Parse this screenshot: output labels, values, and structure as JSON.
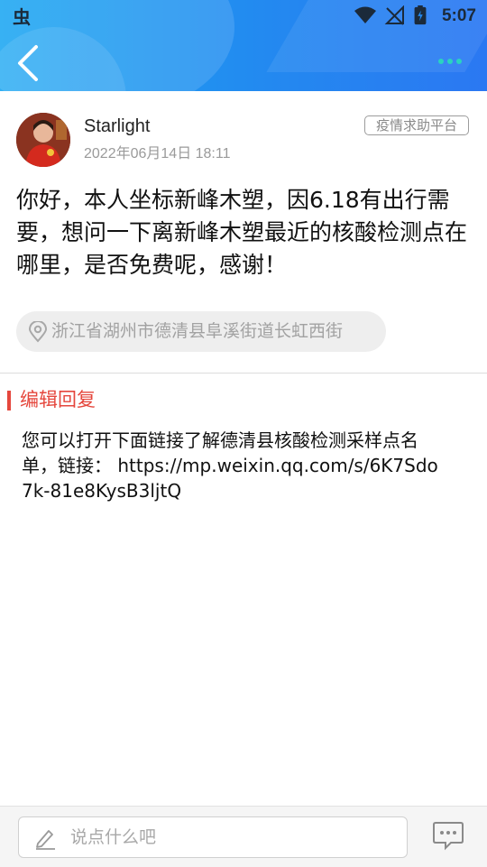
{
  "status_bar": {
    "time": "5:07",
    "app_logo": "虫"
  },
  "header": {
    "back_icon": "chevron-left-icon",
    "more_icon": "more-dots-icon"
  },
  "post": {
    "author": "Starlight",
    "time": "2022年06月14日 18:11",
    "badge": "疫情求助平台",
    "content": "你好，本人坐标新峰木塑，因6.18有出行需要，想问一下离新峰木塑最近的核酸检测点在哪里，是否免费呢，感谢！",
    "location": "浙江省湖州市德清县阜溪街道长虹西街"
  },
  "reply": {
    "title": "编辑回复",
    "content": "您可以打开下面链接了解德清县核酸检测采样点名单，链接： https://mp.weixin.qq.com/s/6K7Sdo7k-81e8KysB3ljtQ"
  },
  "bottom": {
    "placeholder": "说点什么吧"
  },
  "colors": {
    "header": "#2389f0",
    "accent_red": "#e5473d",
    "dots": "#2ad3c0"
  }
}
